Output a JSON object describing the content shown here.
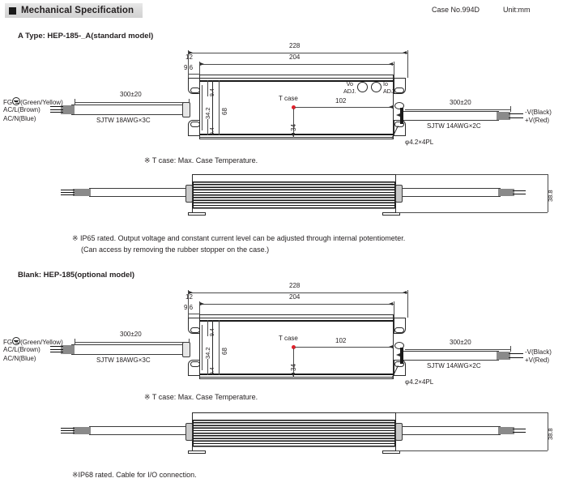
{
  "header": {
    "title": "Mechanical Specification",
    "case_no": "Case No.994D",
    "unit": "Unit:mm",
    "bullet_icon": "black-square-icon",
    "bar_color": "#dcdcdc"
  },
  "sections": [
    {
      "id": "a-type",
      "heading": "A Type: HEP-185-_A(standard model)",
      "tcase_note": "※ T case: Max. Case Temperature.",
      "has_adjust_holes": true,
      "notes": [
        "※ IP65 rated. Output voltage and constant current level can be adjusted through internal potentiometer.",
        "(Can access by removing the rubber stopper on the case.)"
      ],
      "dimensions": {
        "overall_length": "228",
        "body_length": "204",
        "end_offset": "12",
        "bracket_offset": "9.6",
        "hole_pitch_top": "9.4",
        "hole_pitch_bottom": "9.4",
        "inner_width": "34.2",
        "body_width": "68",
        "tcase_x": "102",
        "tcase_y": "34",
        "height": "38.8",
        "mount_hole": "φ4.2×4PL"
      },
      "input_cable": {
        "length": "300±20",
        "spec": "SJTW 18AWG×3C",
        "wires": [
          "FG",
          "(Green/Yellow)",
          "AC/L(Brown)",
          "AC/N(Blue)"
        ]
      },
      "output_cable": {
        "length": "300±20",
        "spec": "SJTW 14AWG×2C",
        "wires": [
          "-V(Black)",
          "+V(Red)"
        ]
      },
      "adjust": {
        "left_label_top": "Vo",
        "left_label_bottom": "ADJ.",
        "right_label_top": "Io",
        "right_label_bottom": "ADJ."
      },
      "tcase_label": "T case"
    },
    {
      "id": "blank-type",
      "heading": "Blank: HEP-185(optional model)",
      "tcase_note": "※ T case: Max. Case Temperature.",
      "has_adjust_holes": false,
      "notes": [
        "※IP68 rated. Cable for I/O connection."
      ],
      "dimensions": {
        "overall_length": "228",
        "body_length": "204",
        "end_offset": "12",
        "bracket_offset": "9.6",
        "hole_pitch_top": "9.4",
        "hole_pitch_bottom": "9.4",
        "inner_width": "34.2",
        "body_width": "68",
        "tcase_x": "102",
        "tcase_y": "34",
        "height": "38.8",
        "mount_hole": "φ4.2×4PL"
      },
      "input_cable": {
        "length": "300±20",
        "spec": "SJTW 18AWG×3C",
        "wires": [
          "FG",
          "(Green/Yellow)",
          "AC/L(Brown)",
          "AC/N(Blue)"
        ]
      },
      "output_cable": {
        "length": "300±20",
        "spec": "SJTW 14AWG×2C",
        "wires": [
          "-V(Black)",
          "+V(Red)"
        ]
      },
      "tcase_label": "T case"
    }
  ],
  "colors": {
    "line": "#2b2b2b",
    "tcase_dot": "#e1202a",
    "text": "#231f20"
  }
}
